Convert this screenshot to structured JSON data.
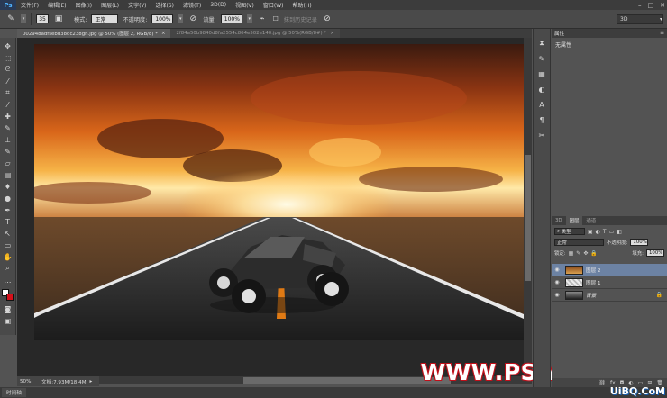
{
  "app": {
    "logo": "Ps"
  },
  "menu": [
    "文件(F)",
    "编辑(E)",
    "图像(I)",
    "图层(L)",
    "文字(Y)",
    "选择(S)",
    "滤镜(T)",
    "3D(D)",
    "视图(V)",
    "窗口(W)",
    "帮助(H)"
  ],
  "window_controls": {
    "minimize": "–",
    "restore": "□",
    "close": "✕"
  },
  "options": {
    "brush_size": "35",
    "mode_label": "模式:",
    "mode_value": "正常",
    "opacity_label": "不透明度:",
    "opacity_value": "100%",
    "flow_label": "流量:",
    "flow_value": "100%",
    "history_label": "抹到历史记录",
    "workspace": "3D"
  },
  "tabs": [
    {
      "label": "002948adfsebd38dc238gh.jpg @ 50% (图层 2, RGB/8) *",
      "close": "×"
    },
    {
      "label": "2f84a50b9840d8fa2554c864e502e140.jpg @ 50%(RGB/8#) *",
      "close": "×"
    }
  ],
  "status": {
    "zoom": "50%",
    "doc_size": "文档:7.93M/18.4M"
  },
  "bottom": {
    "timeline_tab": "时间轴"
  },
  "watermark": {
    "text": "WWW.PSAHZ.COM",
    "sub": "UiBQ.CoM"
  },
  "properties": {
    "title": "属性",
    "content": "无属性"
  },
  "layers": {
    "tabs": [
      "3D",
      "图层",
      "通道"
    ],
    "filter_label": "类型",
    "blend_mode": "正常",
    "opacity_label": "不透明度:",
    "opacity_value": "100%",
    "lock_label": "锁定:",
    "fill_label": "填充:",
    "fill_value": "100%",
    "items": [
      {
        "name": "图层 2"
      },
      {
        "name": "图层 1"
      },
      {
        "name": "背景"
      }
    ]
  },
  "colors": {
    "foreground": "#ffffff",
    "background": "#d4101a",
    "selected_layer": "#6c82a3"
  }
}
